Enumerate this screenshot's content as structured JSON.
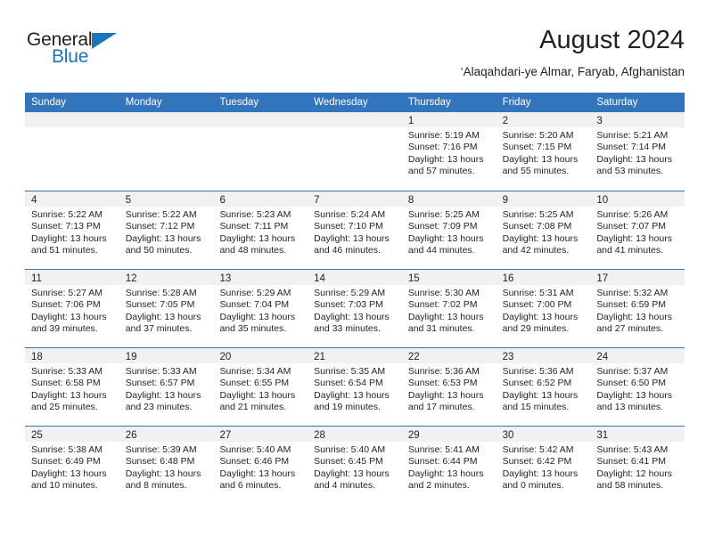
{
  "brand": {
    "name_top": "General",
    "name_bottom": "Blue",
    "triangle_color": "#1b75bb",
    "text_color": "#231f20"
  },
  "header": {
    "title": "August 2024",
    "location": "‘Alaqahdari-ye Almar, Faryab, Afghanistan"
  },
  "theme": {
    "header_bar_color": "#3275bc",
    "day_band_color": "#f1f1f1",
    "row_border_color": "#3275bc",
    "text_color": "#231f20",
    "header_text_color": "#ffffff"
  },
  "calendar": {
    "weekdays": [
      "Sunday",
      "Monday",
      "Tuesday",
      "Wednesday",
      "Thursday",
      "Friday",
      "Saturday"
    ],
    "weeks": [
      [
        {
          "day": "",
          "empty": true,
          "lines": []
        },
        {
          "day": "",
          "empty": true,
          "lines": []
        },
        {
          "day": "",
          "empty": true,
          "lines": []
        },
        {
          "day": "",
          "empty": true,
          "lines": []
        },
        {
          "day": "1",
          "empty": false,
          "lines": [
            "Sunrise: 5:19 AM",
            "Sunset: 7:16 PM",
            "Daylight: 13 hours",
            "and 57 minutes."
          ]
        },
        {
          "day": "2",
          "empty": false,
          "lines": [
            "Sunrise: 5:20 AM",
            "Sunset: 7:15 PM",
            "Daylight: 13 hours",
            "and 55 minutes."
          ]
        },
        {
          "day": "3",
          "empty": false,
          "lines": [
            "Sunrise: 5:21 AM",
            "Sunset: 7:14 PM",
            "Daylight: 13 hours",
            "and 53 minutes."
          ]
        }
      ],
      [
        {
          "day": "4",
          "empty": false,
          "lines": [
            "Sunrise: 5:22 AM",
            "Sunset: 7:13 PM",
            "Daylight: 13 hours",
            "and 51 minutes."
          ]
        },
        {
          "day": "5",
          "empty": false,
          "lines": [
            "Sunrise: 5:22 AM",
            "Sunset: 7:12 PM",
            "Daylight: 13 hours",
            "and 50 minutes."
          ]
        },
        {
          "day": "6",
          "empty": false,
          "lines": [
            "Sunrise: 5:23 AM",
            "Sunset: 7:11 PM",
            "Daylight: 13 hours",
            "and 48 minutes."
          ]
        },
        {
          "day": "7",
          "empty": false,
          "lines": [
            "Sunrise: 5:24 AM",
            "Sunset: 7:10 PM",
            "Daylight: 13 hours",
            "and 46 minutes."
          ]
        },
        {
          "day": "8",
          "empty": false,
          "lines": [
            "Sunrise: 5:25 AM",
            "Sunset: 7:09 PM",
            "Daylight: 13 hours",
            "and 44 minutes."
          ]
        },
        {
          "day": "9",
          "empty": false,
          "lines": [
            "Sunrise: 5:25 AM",
            "Sunset: 7:08 PM",
            "Daylight: 13 hours",
            "and 42 minutes."
          ]
        },
        {
          "day": "10",
          "empty": false,
          "lines": [
            "Sunrise: 5:26 AM",
            "Sunset: 7:07 PM",
            "Daylight: 13 hours",
            "and 41 minutes."
          ]
        }
      ],
      [
        {
          "day": "11",
          "empty": false,
          "lines": [
            "Sunrise: 5:27 AM",
            "Sunset: 7:06 PM",
            "Daylight: 13 hours",
            "and 39 minutes."
          ]
        },
        {
          "day": "12",
          "empty": false,
          "lines": [
            "Sunrise: 5:28 AM",
            "Sunset: 7:05 PM",
            "Daylight: 13 hours",
            "and 37 minutes."
          ]
        },
        {
          "day": "13",
          "empty": false,
          "lines": [
            "Sunrise: 5:29 AM",
            "Sunset: 7:04 PM",
            "Daylight: 13 hours",
            "and 35 minutes."
          ]
        },
        {
          "day": "14",
          "empty": false,
          "lines": [
            "Sunrise: 5:29 AM",
            "Sunset: 7:03 PM",
            "Daylight: 13 hours",
            "and 33 minutes."
          ]
        },
        {
          "day": "15",
          "empty": false,
          "lines": [
            "Sunrise: 5:30 AM",
            "Sunset: 7:02 PM",
            "Daylight: 13 hours",
            "and 31 minutes."
          ]
        },
        {
          "day": "16",
          "empty": false,
          "lines": [
            "Sunrise: 5:31 AM",
            "Sunset: 7:00 PM",
            "Daylight: 13 hours",
            "and 29 minutes."
          ]
        },
        {
          "day": "17",
          "empty": false,
          "lines": [
            "Sunrise: 5:32 AM",
            "Sunset: 6:59 PM",
            "Daylight: 13 hours",
            "and 27 minutes."
          ]
        }
      ],
      [
        {
          "day": "18",
          "empty": false,
          "lines": [
            "Sunrise: 5:33 AM",
            "Sunset: 6:58 PM",
            "Daylight: 13 hours",
            "and 25 minutes."
          ]
        },
        {
          "day": "19",
          "empty": false,
          "lines": [
            "Sunrise: 5:33 AM",
            "Sunset: 6:57 PM",
            "Daylight: 13 hours",
            "and 23 minutes."
          ]
        },
        {
          "day": "20",
          "empty": false,
          "lines": [
            "Sunrise: 5:34 AM",
            "Sunset: 6:55 PM",
            "Daylight: 13 hours",
            "and 21 minutes."
          ]
        },
        {
          "day": "21",
          "empty": false,
          "lines": [
            "Sunrise: 5:35 AM",
            "Sunset: 6:54 PM",
            "Daylight: 13 hours",
            "and 19 minutes."
          ]
        },
        {
          "day": "22",
          "empty": false,
          "lines": [
            "Sunrise: 5:36 AM",
            "Sunset: 6:53 PM",
            "Daylight: 13 hours",
            "and 17 minutes."
          ]
        },
        {
          "day": "23",
          "empty": false,
          "lines": [
            "Sunrise: 5:36 AM",
            "Sunset: 6:52 PM",
            "Daylight: 13 hours",
            "and 15 minutes."
          ]
        },
        {
          "day": "24",
          "empty": false,
          "lines": [
            "Sunrise: 5:37 AM",
            "Sunset: 6:50 PM",
            "Daylight: 13 hours",
            "and 13 minutes."
          ]
        }
      ],
      [
        {
          "day": "25",
          "empty": false,
          "lines": [
            "Sunrise: 5:38 AM",
            "Sunset: 6:49 PM",
            "Daylight: 13 hours",
            "and 10 minutes."
          ]
        },
        {
          "day": "26",
          "empty": false,
          "lines": [
            "Sunrise: 5:39 AM",
            "Sunset: 6:48 PM",
            "Daylight: 13 hours",
            "and 8 minutes."
          ]
        },
        {
          "day": "27",
          "empty": false,
          "lines": [
            "Sunrise: 5:40 AM",
            "Sunset: 6:46 PM",
            "Daylight: 13 hours",
            "and 6 minutes."
          ]
        },
        {
          "day": "28",
          "empty": false,
          "lines": [
            "Sunrise: 5:40 AM",
            "Sunset: 6:45 PM",
            "Daylight: 13 hours",
            "and 4 minutes."
          ]
        },
        {
          "day": "29",
          "empty": false,
          "lines": [
            "Sunrise: 5:41 AM",
            "Sunset: 6:44 PM",
            "Daylight: 13 hours",
            "and 2 minutes."
          ]
        },
        {
          "day": "30",
          "empty": false,
          "lines": [
            "Sunrise: 5:42 AM",
            "Sunset: 6:42 PM",
            "Daylight: 13 hours",
            "and 0 minutes."
          ]
        },
        {
          "day": "31",
          "empty": false,
          "lines": [
            "Sunrise: 5:43 AM",
            "Sunset: 6:41 PM",
            "Daylight: 12 hours",
            "and 58 minutes."
          ]
        }
      ]
    ]
  }
}
